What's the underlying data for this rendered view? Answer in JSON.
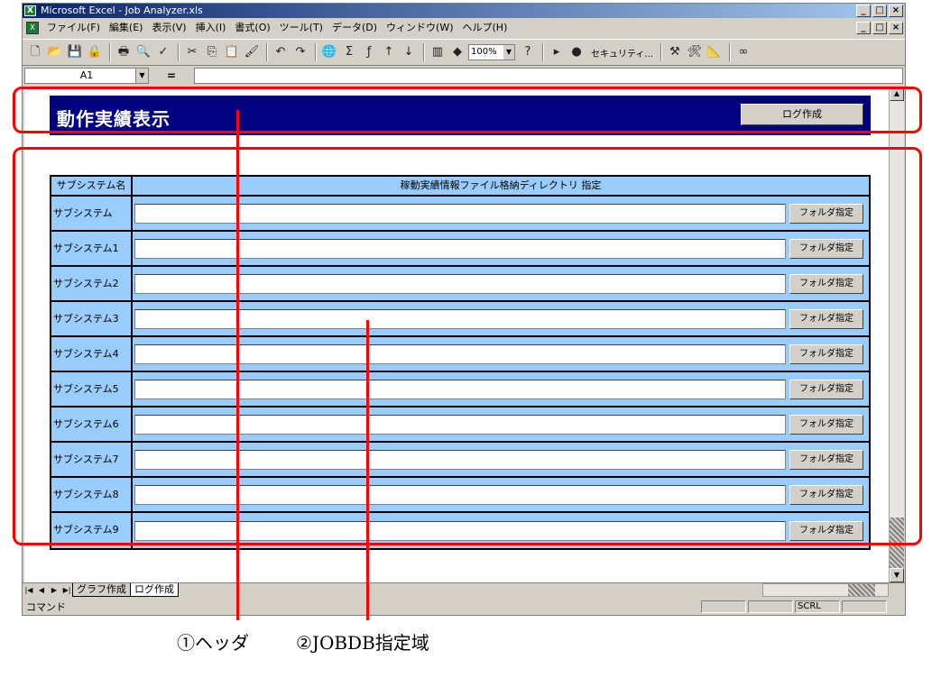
{
  "window": {
    "title": "Microsoft Excel - Job Analyzer.xls",
    "app_icon": "excel-icon",
    "controls": [
      "_",
      "□",
      "×"
    ]
  },
  "menu": {
    "items": [
      "ファイル(F)",
      "編集(E)",
      "表示(V)",
      "挿入(I)",
      "書式(O)",
      "ツール(T)",
      "データ(D)",
      "ウィンドウ(W)",
      "ヘルプ(H)"
    ]
  },
  "toolbar": {
    "zoom": "100%",
    "security_label": "セキュリティ..."
  },
  "formula_bar": {
    "name_box": "A1",
    "equals": "=",
    "value": ""
  },
  "sheet": {
    "header_title": "動作実績表示",
    "log_button": "ログ作成",
    "grid": {
      "col1_header": "サブシステム名",
      "col2_header": "稼動実績情報ファイル格納ディレクトリ 指定",
      "folder_button": "フォルダ指定",
      "rows": [
        {
          "name": "サブシステム",
          "path": ""
        },
        {
          "name": "サブシステム1",
          "path": ""
        },
        {
          "name": "サブシステム2",
          "path": ""
        },
        {
          "name": "サブシステム3",
          "path": ""
        },
        {
          "name": "サブシステム4",
          "path": ""
        },
        {
          "name": "サブシステム5",
          "path": ""
        },
        {
          "name": "サブシステム6",
          "path": ""
        },
        {
          "name": "サブシステム7",
          "path": ""
        },
        {
          "name": "サブシステム8",
          "path": ""
        },
        {
          "name": "サブシステム9",
          "path": ""
        }
      ]
    }
  },
  "tabs": [
    "グラフ作成",
    "ログ作成"
  ],
  "status": {
    "text": "コマンド",
    "scrl": "SCRL"
  },
  "annotations": {
    "caption1": "①ヘッダ",
    "caption2": "②JOBDB指定域",
    "color": "#ff0000"
  }
}
